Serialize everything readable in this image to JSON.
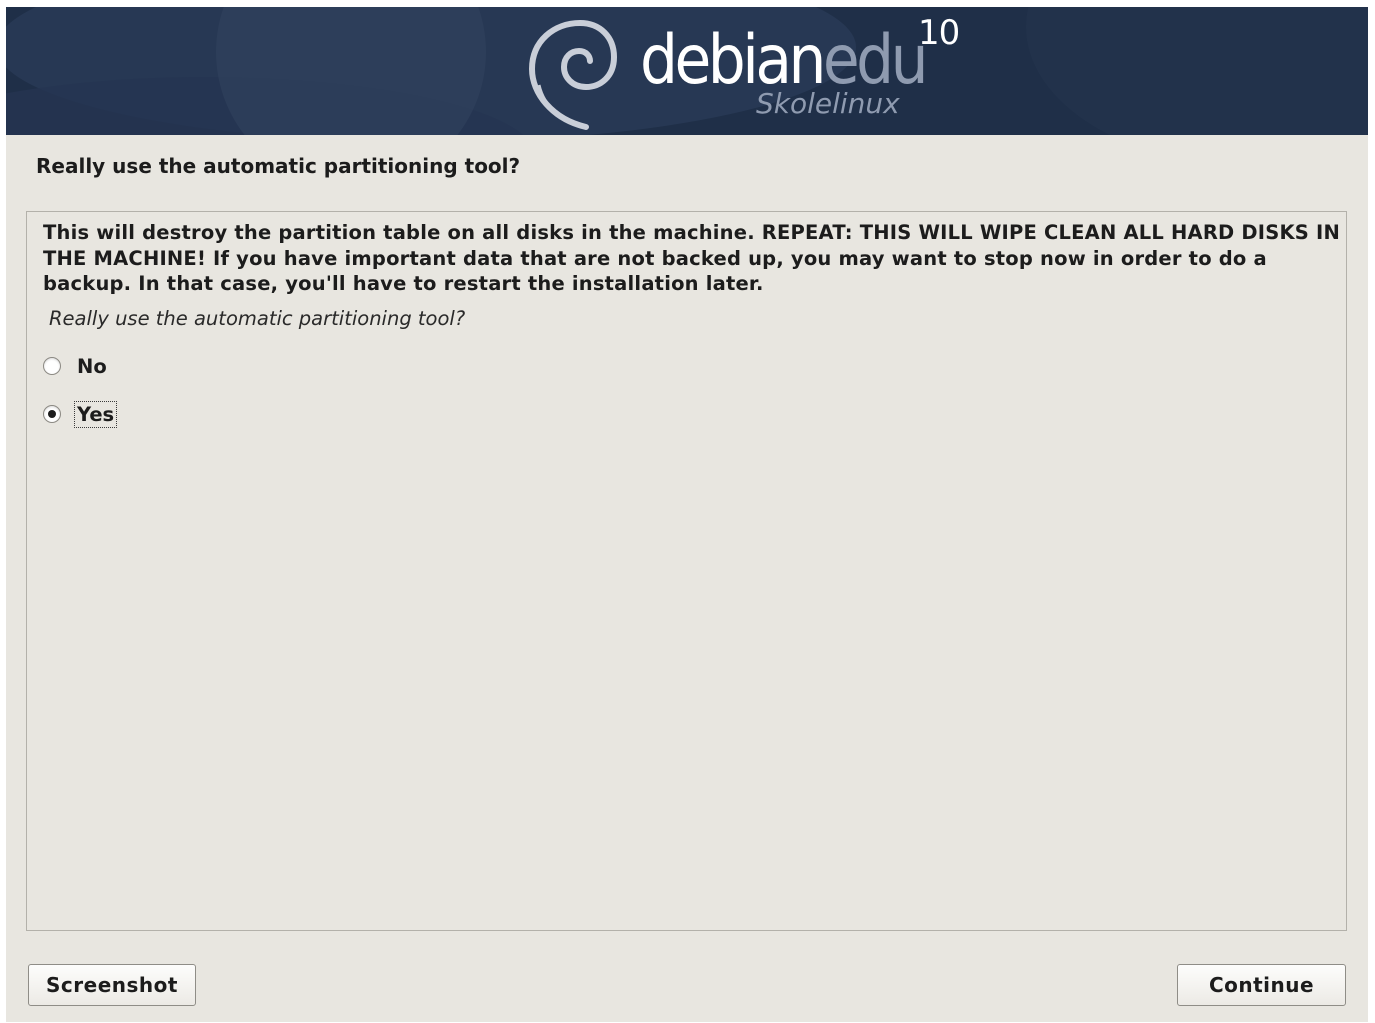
{
  "banner": {
    "logo_word_part1": "debian",
    "logo_word_part2": "edu",
    "logo_version": "10",
    "logo_subtitle": "Skolelinux"
  },
  "page": {
    "title": "Really use the automatic partitioning tool?"
  },
  "content": {
    "description": "This will destroy the partition table on all disks in the machine. REPEAT: THIS WILL WIPE CLEAN ALL HARD DISKS IN THE MACHINE! If you have important data that are not backed up, you may want to stop now in order to do a backup. In that case, you'll have to restart the installation later.",
    "question": "Really use the automatic partitioning tool?",
    "options": [
      {
        "label": "No",
        "selected": false
      },
      {
        "label": "Yes",
        "selected": true
      }
    ]
  },
  "buttons": {
    "screenshot": "Screenshot",
    "continue": "Continue"
  },
  "colors": {
    "banner_background": "#1f2f48",
    "window_background": "#e8e6e0",
    "logo_accent": "#8f9bb0"
  }
}
